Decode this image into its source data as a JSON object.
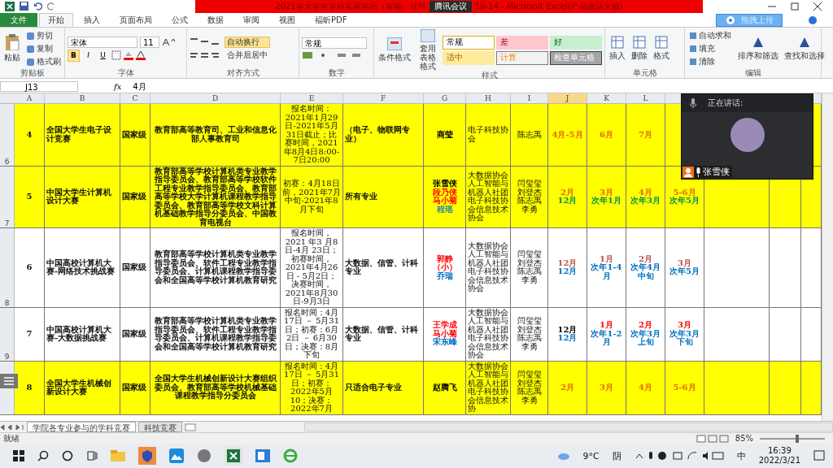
{
  "window": {
    "title_left": "2021年大学生学科竞赛年历（智能、计科",
    "meeting_badge": "腾讯会议",
    "title_right": "10-14 - Microsoft Excel(产品激活失败)"
  },
  "tabs": [
    {
      "label": "文件",
      "kind": "file",
      "selected": false
    },
    {
      "label": "开始",
      "kind": "tab",
      "selected": true
    },
    {
      "label": "插入",
      "kind": "tab",
      "selected": false
    },
    {
      "label": "页面布局",
      "kind": "tab",
      "selected": false
    },
    {
      "label": "公式",
      "kind": "tab",
      "selected": false
    },
    {
      "label": "数据",
      "kind": "tab",
      "selected": false
    },
    {
      "label": "审阅",
      "kind": "tab",
      "selected": false
    },
    {
      "label": "视图",
      "kind": "tab",
      "selected": false
    },
    {
      "label": "福昕PDF",
      "kind": "tab",
      "selected": false
    }
  ],
  "upload_button": "拖拽上传",
  "ribbon": {
    "clipboard": {
      "paste": "粘贴",
      "items": [
        "剪切",
        "复制",
        "格式刷"
      ],
      "label": "剪贴板"
    },
    "font": {
      "name": "宋体",
      "size": "11",
      "format_buttons": [
        "B",
        "I",
        "U"
      ],
      "label": "字体"
    },
    "alignment": {
      "wrap": "自动换行",
      "wrap_on": true,
      "merge": "合并后居中",
      "label": "对齐方式"
    },
    "number": {
      "format": "常规",
      "label": "数字"
    },
    "styles": {
      "conditional": "条件格式",
      "table": "套用表格格式",
      "cells": [
        {
          "label": "常规",
          "kind": "normal"
        },
        {
          "label": "差",
          "kind": "bad"
        },
        {
          "label": "好",
          "kind": "good"
        },
        {
          "label": "适中",
          "kind": "neutral"
        },
        {
          "label": "计算",
          "kind": "calc"
        },
        {
          "label": "检查单元格",
          "kind": "check"
        }
      ],
      "label": "样式"
    },
    "cells": {
      "buttons": [
        "插入",
        "删除",
        "格式"
      ],
      "label": "单元格"
    },
    "editing": {
      "items": [
        "自动求和",
        "填充",
        "清除"
      ],
      "big": [
        "排序和筛选",
        "查找和选择"
      ],
      "label": "编辑"
    }
  },
  "formula_bar": {
    "name_box": "J13",
    "function_label": "fx",
    "value": "4月"
  },
  "columns": [
    {
      "label": "A",
      "selected": false
    },
    {
      "label": "B",
      "selected": false
    },
    {
      "label": "C",
      "selected": false
    },
    {
      "label": "D",
      "selected": false
    },
    {
      "label": "E",
      "selected": false
    },
    {
      "label": "F",
      "selected": false
    },
    {
      "label": "G",
      "selected": false
    },
    {
      "label": "H",
      "selected": false
    },
    {
      "label": "I",
      "selected": false
    },
    {
      "label": "J",
      "selected": true
    },
    {
      "label": "K",
      "selected": false
    },
    {
      "label": "L",
      "selected": false
    }
  ],
  "rows": [
    {
      "row_number": "6",
      "highlighted": true,
      "index": "4",
      "name": "全国大学生电子设计竞赛",
      "level": "国家级",
      "organizer": "教育部高等教育司、工业和信息化部人事教育司",
      "schedule": "报名时间：2021年1月29日-2021年5月31日截止；比赛时间，2021年8月4日8:00-7日20:00",
      "majors": "（电子、物联网专业）",
      "contacts": [
        {
          "text": "商莹",
          "color": "#000000"
        }
      ],
      "clubs": "电子科技协会",
      "teachers": [
        "陈志禹"
      ],
      "months": [
        [
          {
            "text": "4月-5月",
            "color": "#e36c09"
          }
        ],
        [
          {
            "text": "6月",
            "color": "#e36c09"
          }
        ],
        [
          {
            "text": "7月",
            "color": "#e36c09"
          }
        ]
      ]
    },
    {
      "row_number": "7",
      "highlighted": true,
      "index": "5",
      "name": "中国大学生计算机设计大赛",
      "level": "国家级",
      "organizer": "教育部高等学校计算机类专业教学指导委员会、教育部高等学校软件工程专业教学指导委员会、教育部高等学校大学计算机课程教学指导委员会、教育部高等学校文科计算机基础教学指导分委员会、中国教育电视台",
      "schedule": "初赛：4月18日前，2021年7月中旬-2021年8月下旬",
      "majors": "所有专业",
      "contacts": [
        {
          "text": "张雪侠",
          "color": "#000000"
        },
        {
          "text": "段乃侠",
          "color": "#ff0000"
        },
        {
          "text": "马小菊",
          "color": "#ff0000"
        },
        {
          "text": "程瑶",
          "color": "#31859c"
        }
      ],
      "clubs": "大数据协会人工智能与机器人社团电子科技协会信息技术协会",
      "teachers": [
        "闫玺玺",
        "刘登杰",
        "陈志禹",
        "李勇"
      ],
      "months": [
        [
          {
            "text": "2月",
            "color": "#e36c09"
          },
          {
            "text": "12月",
            "color": "#00944a"
          }
        ],
        [
          {
            "text": "3月",
            "color": "#e36c09"
          },
          {
            "text": "次年1月",
            "color": "#00944a"
          }
        ],
        [
          {
            "text": "4月",
            "color": "#e36c09"
          },
          {
            "text": "次年3月",
            "color": "#00944a"
          }
        ],
        [
          {
            "text": "5-6月",
            "color": "#e36c09"
          },
          {
            "text": "次年5月",
            "color": "#00944a"
          }
        ]
      ]
    },
    {
      "row_number": "8",
      "highlighted": false,
      "index": "6",
      "name": "中国高校计算机大赛-网络技术挑战赛",
      "level": "国家级",
      "organizer": "教育部高等学校计算机类专业教学指导委员会、软件工程专业教学指导委员会、计算机课程教学指导委会和全国高等学校计算机教育研究",
      "schedule": "报名时间，2021 年3 月8日-4月 23日；初赛时间，2021年4月26日 - 5月2日；决赛时间，2021年8月30日-9月3日",
      "majors": "大数据、信管、计科专业",
      "contacts": [
        {
          "text": "郭静（小）",
          "color": "#ff0000"
        },
        {
          "text": "乔瑞",
          "color": "#0070c0"
        }
      ],
      "clubs": "大数据协会人工智能与机器人社团电子科技协会信息技术协会",
      "teachers": [
        "闫玺玺",
        "刘登杰",
        "陈志禹",
        "李勇"
      ],
      "months": [
        [
          {
            "text": "12月",
            "color": "#c0504d"
          },
          {
            "text": "12月",
            "color": "#0070c0"
          }
        ],
        [
          {
            "text": "1月",
            "color": "#c0504d"
          },
          {
            "text": "次年1-4月",
            "color": "#0070c0"
          }
        ],
        [
          {
            "text": "2月",
            "color": "#c0504d"
          },
          {
            "text": "次年4月中旬",
            "color": "#0070c0"
          }
        ],
        [
          {
            "text": "3月",
            "color": "#c0504d"
          },
          {
            "text": "次年5月",
            "color": "#0070c0"
          }
        ]
      ]
    },
    {
      "row_number": "9",
      "highlighted": false,
      "index": "7",
      "name": "中国高校计算机大赛-大数据挑战赛",
      "level": "国家级",
      "organizer": "教育部高等学校计算机类专业教学指导委员会、软件工程专业教学指导委员会、计算机课程教学指导委会和全国高等学校计算机教育研究",
      "schedule": "报名时间：4月17日 － 5月31日；初赛：6月2日 － 6月30日；决赛：8月下旬",
      "majors": "大数据、信管、计科专业",
      "contacts": [
        {
          "text": "王学成",
          "color": "#ff0000"
        },
        {
          "text": "马小菊",
          "color": "#ff0000"
        },
        {
          "text": "宋东峰",
          "color": "#0070c0"
        }
      ],
      "clubs": "大数据协会人工智能与机器人社团电子科技协会信息技术协会",
      "teachers": [
        "闫玺玺",
        "刘登杰",
        "陈志禹",
        "李勇"
      ],
      "months": [
        [
          {
            "text": "12月",
            "color": "#000000"
          },
          {
            "text": "12月",
            "color": "#0070c0"
          }
        ],
        [
          {
            "text": "1月",
            "color": "#ff0000"
          },
          {
            "text": "次年1-2月",
            "color": "#0070c0"
          }
        ],
        [
          {
            "text": "2月",
            "color": "#ff0000"
          },
          {
            "text": "次年3月上旬",
            "color": "#0070c0"
          }
        ],
        [
          {
            "text": "3月",
            "color": "#ff0000"
          },
          {
            "text": "次年3月下旬",
            "color": "#0070c0"
          }
        ]
      ]
    },
    {
      "highlighted": true,
      "index": "8",
      "name": "全国大学生机械创新设计大赛",
      "level": "国家级",
      "organizer": "全国大学生机械创新设计大赛组织委员会、教育部高等学校机械基础课程教学指导分委员会",
      "schedule": "报名时间：4月17日 － 5月31日；初赛：2022年5月10；决赛：2022年7月",
      "majors": "只适合电子专业",
      "contacts": [
        {
          "text": "赵腾飞",
          "color": "#000000"
        }
      ],
      "clubs": "大数据协会人工智能与机器人社团电子科技协会信息技术协",
      "teachers": [
        "闫玺玺",
        "刘登杰",
        "陈志禹",
        "李勇"
      ],
      "months": [
        [
          {
            "text": "2月",
            "color": "#e36c09"
          }
        ],
        [
          {
            "text": "3月",
            "color": "#e36c09"
          }
        ],
        [
          {
            "text": "4月",
            "color": "#e36c09"
          }
        ],
        [
          {
            "text": "5-6月",
            "color": "#e36c09"
          }
        ]
      ]
    }
  ],
  "speaker": {
    "heading": "正在讲话:",
    "name": "张雪侠"
  },
  "sheet_tabs": [
    {
      "label": "学院各专业参与的学科竞赛",
      "selected": true
    },
    {
      "label": "科技竞赛",
      "selected": false
    }
  ],
  "status_bar": {
    "ready": "就绪",
    "zoom": "85%",
    "zoom_slider": {
      "level": 0.58
    }
  },
  "taskbar": {
    "weather": "9°C",
    "condition": "阴",
    "ime": "中",
    "time": "16:39",
    "date": "2022/3/21"
  }
}
